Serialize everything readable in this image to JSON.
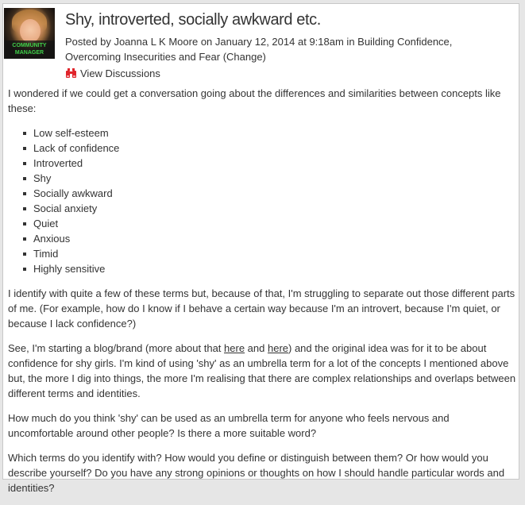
{
  "post": {
    "title": "Shy, introverted, socially awkward etc.",
    "author_badge": "Community Manager",
    "meta": {
      "prefix": "Posted by ",
      "author": "Joanna L K Moore",
      "on": " on ",
      "date": "January 12, 2014",
      "at": " at ",
      "time": "9:18am",
      "in": " in ",
      "categories": "Building Confidence, Overcoming Insecurities and Fear (Change)"
    },
    "view_discussions": {
      "label": "View Discussions",
      "icon": "binoculars-icon",
      "icon_color": "#e0242b"
    }
  },
  "body": {
    "intro": "I wondered if we could get a conversation going about the differences and similarities between concepts like these:",
    "list": [
      "Low self-esteem",
      "Lack of confidence",
      "Introverted",
      "Shy",
      "Socially awkward",
      "Social anxiety",
      "Quiet",
      "Anxious",
      "Timid",
      "Highly sensitive"
    ],
    "p1": "I identify with quite a few of these terms but, because of that, I'm struggling to separate out those different parts of me. (For example, how do I know if I behave a certain way because I'm an introvert, because I'm quiet, or because I lack confidence?)",
    "p2": {
      "a": "See, I'm starting a blog/brand (more about that ",
      "link1": "here",
      "b": " and ",
      "link2": "here",
      "c": ") and the original idea was for it to be about confidence for shy girls. I'm kind of using 'shy' as an umbrella term for a lot of the concepts I mentioned above but, the more I dig into things, the more I'm realising that there are complex relationships and overlaps between different terms and identities."
    },
    "p3": "How much do you think 'shy' can be used as an umbrella term for anyone who feels nervous and uncomfortable around other people? Is there a more suitable word?",
    "p4": "Which terms do you identify with? How would you define or distinguish between them? Or how would you describe yourself? Do you have any strong opinions or thoughts on how I should handle particular words and identities?"
  }
}
